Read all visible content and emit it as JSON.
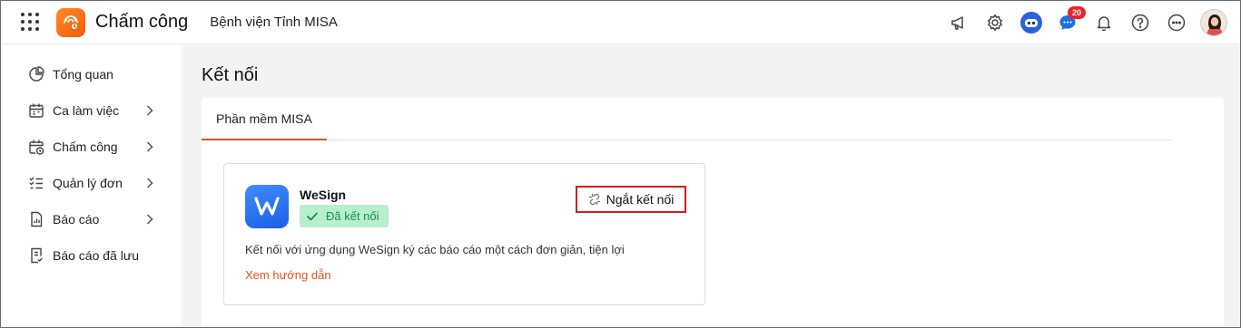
{
  "header": {
    "app_name": "Chấm công",
    "org_name": "Bệnh viện Tỉnh MISA",
    "notification_count": "20",
    "icons": [
      "apps-grid-icon",
      "app-logo-icon",
      "megaphone-icon",
      "gear-icon",
      "bot-icon",
      "chat-icon",
      "bell-icon",
      "help-icon",
      "more-icon",
      "avatar"
    ]
  },
  "sidebar": {
    "items": [
      {
        "label": "Tổng quan",
        "icon": "pie-chart-icon",
        "has_submenu": false
      },
      {
        "label": "Ca làm việc",
        "icon": "calendar-icon",
        "has_submenu": true
      },
      {
        "label": "Chấm công",
        "icon": "calendar-clock-icon",
        "has_submenu": true
      },
      {
        "label": "Quản lý đơn",
        "icon": "checklist-icon",
        "has_submenu": true
      },
      {
        "label": "Báo cáo",
        "icon": "report-icon",
        "has_submenu": true
      },
      {
        "label": "Báo cáo đã lưu",
        "icon": "saved-report-icon",
        "has_submenu": false
      }
    ]
  },
  "main": {
    "title": "Kết nối",
    "tabs": [
      {
        "label": "Phần mềm MISA",
        "active": true
      }
    ],
    "card": {
      "name": "WeSign",
      "status": "Đã kết nối",
      "disconnect_label": "Ngắt kết nối",
      "description": "Kết nối với ứng dụng WeSign ký các báo cáo một cách đơn giản, tiện lợi",
      "guide_link": "Xem hướng dẫn"
    }
  },
  "colors": {
    "accent": "#e6531c",
    "status_bg": "#b8efcd",
    "status_text": "#17924a",
    "highlight_border": "#d0201f",
    "wesign_blue": "#2a6ff0"
  }
}
